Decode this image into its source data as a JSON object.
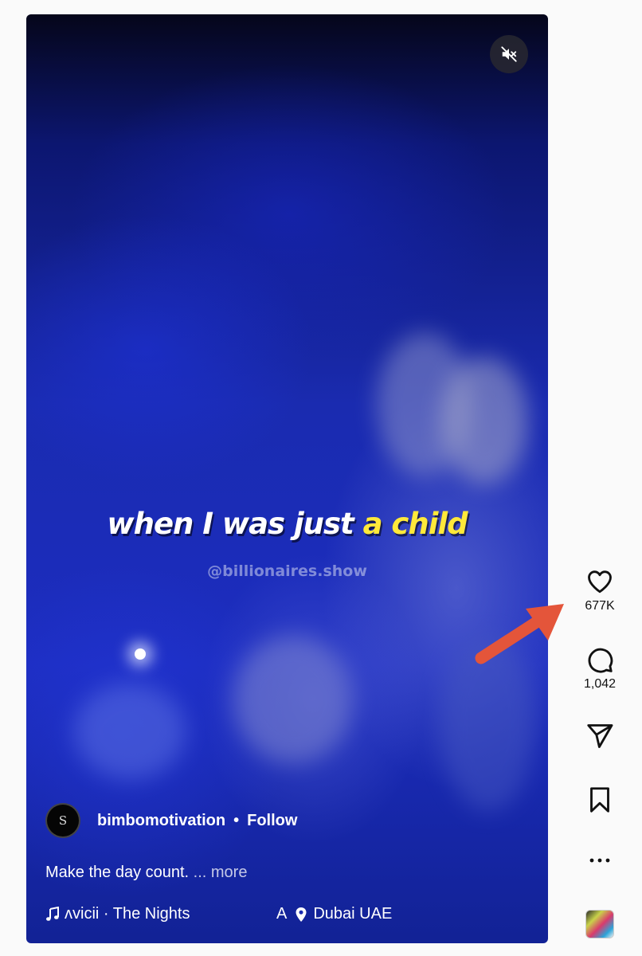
{
  "post": {
    "caption_before": "when I was just ",
    "caption_highlight": "a child",
    "watermark": "@billionaires.show",
    "author": {
      "avatar_text": "S",
      "username": "bimbomotivation",
      "separator": "•",
      "follow_label": "Follow"
    },
    "description": "Make the day count.",
    "more_label": "... more",
    "audio": "ʌvicii · The Nights",
    "location_fragment": "A",
    "location": "Dubai UAE"
  },
  "actions": {
    "likes": "677K",
    "comments": "1,042"
  },
  "icons": {
    "mute": "speaker-muted-icon",
    "like": "heart-icon",
    "comment": "comment-bubble-icon",
    "share": "paper-plane-icon",
    "save": "bookmark-icon",
    "more": "more-dots-icon",
    "audio": "music-note-icon",
    "location": "location-pin-icon"
  },
  "colors": {
    "caption_highlight": "#ffe93a",
    "annotation_arrow": "#e4553a",
    "page_background": "#fafafa"
  }
}
